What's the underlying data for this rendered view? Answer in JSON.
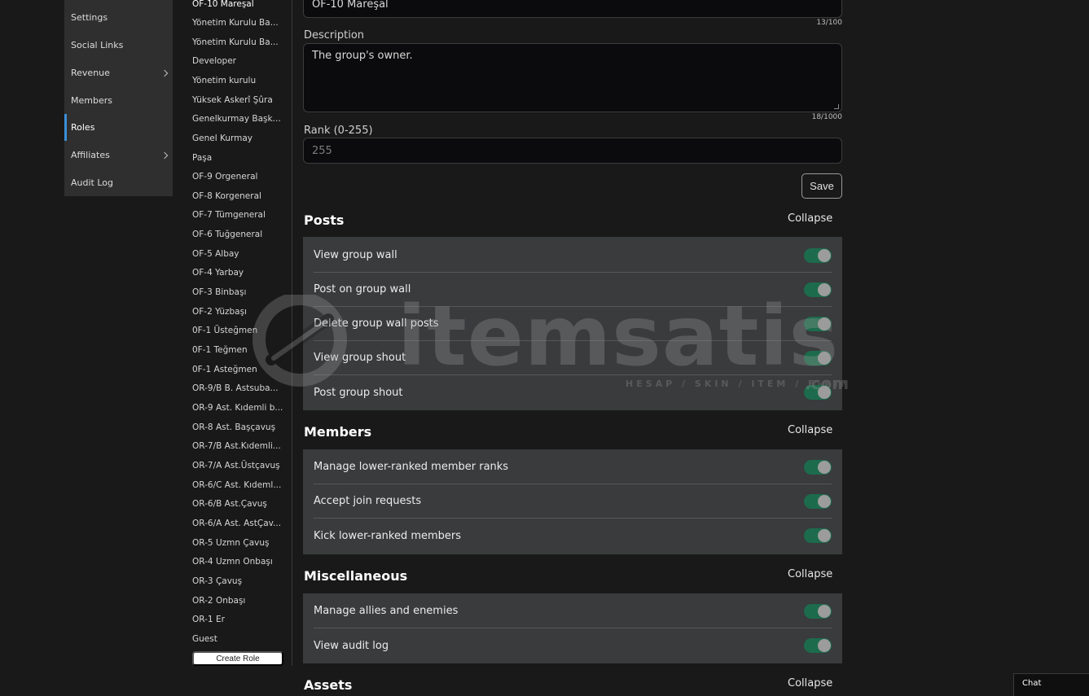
{
  "left_menu": {
    "items": [
      {
        "label": "Settings",
        "active": false,
        "has_submenu": false
      },
      {
        "label": "Social Links",
        "active": false,
        "has_submenu": false
      },
      {
        "label": "Revenue",
        "active": false,
        "has_submenu": true
      },
      {
        "label": "Members",
        "active": false,
        "has_submenu": false
      },
      {
        "label": "Roles",
        "active": true,
        "has_submenu": false
      },
      {
        "label": "Affiliates",
        "active": false,
        "has_submenu": true
      },
      {
        "label": "Audit Log",
        "active": false,
        "has_submenu": false
      }
    ]
  },
  "roles": {
    "items": [
      "OF-10 Mareşal",
      "Yönetim Kurulu Ba...",
      "Yönetim Kurulu Ba...",
      "Developer",
      "Yönetim kurulu",
      "Yüksek Askerî Şûra",
      "Genelkurmay Başka...",
      "Genel Kurmay",
      "Paşa",
      "OF-9 Orgeneral",
      "OF-8 Korgeneral",
      "OF-7 Tümgeneral",
      "OF-6 Tuğgeneral",
      "OF-5 Albay",
      "OF-4 Yarbay",
      "OF-3 Binbaşı",
      "OF-2 Yüzbaşı",
      "0F-1 Üsteğmen",
      "0F-1 Teğmen",
      "0F-1 Asteğmen",
      "OR-9/B B. Astsuba...",
      "OR-9 Ast. Kıdemli b...",
      "OR-8 Ast. Başçavuş",
      "OR-7/B Ast.Kıdemli...",
      "OR-7/A Ast.Üstçavuş",
      "OR-6/C Ast. Kıdeml...",
      "OR-6/B Ast.Çavuş",
      "OR-6/A Ast. AstÇav...",
      "OR-5 Uzmn Çavuş",
      "OR-4 Uzmn Onbaşı",
      "OR-3 Çavuş",
      "OR-2 Onbaşı",
      "OR-1 Er",
      "Guest"
    ],
    "selected_index": 0,
    "create_label": "Create Role"
  },
  "form": {
    "name_value": "OF-10 Mareşal",
    "name_counter": "13/100",
    "description_label": "Description",
    "description_value": "The group's owner.",
    "description_counter": "18/1000",
    "rank_label": "Rank (0-255)",
    "rank_placeholder": "255",
    "save_label": "Save"
  },
  "sections": [
    {
      "title": "Posts",
      "collapse_label": "Collapse",
      "permissions": [
        {
          "label": "View group wall",
          "enabled": true
        },
        {
          "label": "Post on group wall",
          "enabled": true
        },
        {
          "label": "Delete group wall posts",
          "enabled": true
        },
        {
          "label": "View group shout",
          "enabled": true
        },
        {
          "label": "Post group shout",
          "enabled": true
        }
      ]
    },
    {
      "title": "Members",
      "collapse_label": "Collapse",
      "permissions": [
        {
          "label": "Manage lower-ranked member ranks",
          "enabled": true
        },
        {
          "label": "Accept join requests",
          "enabled": true
        },
        {
          "label": "Kick lower-ranked members",
          "enabled": true
        }
      ]
    },
    {
      "title": "Miscellaneous",
      "collapse_label": "Collapse",
      "permissions": [
        {
          "label": "Manage allies and enemies",
          "enabled": true
        },
        {
          "label": "View audit log",
          "enabled": true
        }
      ]
    },
    {
      "title": "Assets",
      "collapse_label": "Collapse",
      "permissions": []
    }
  ],
  "watermark": {
    "text": "itemsatis",
    "tagline": "HESAP / SKIN / ITEM / E-PIN",
    "tld": ".com"
  },
  "chat": {
    "label": "Chat"
  },
  "colors": {
    "accent_active": "#3a8fd8",
    "toggle_on": "#1d6b4d",
    "panel_bg": "#393b3d",
    "page_bg": "#191919"
  }
}
